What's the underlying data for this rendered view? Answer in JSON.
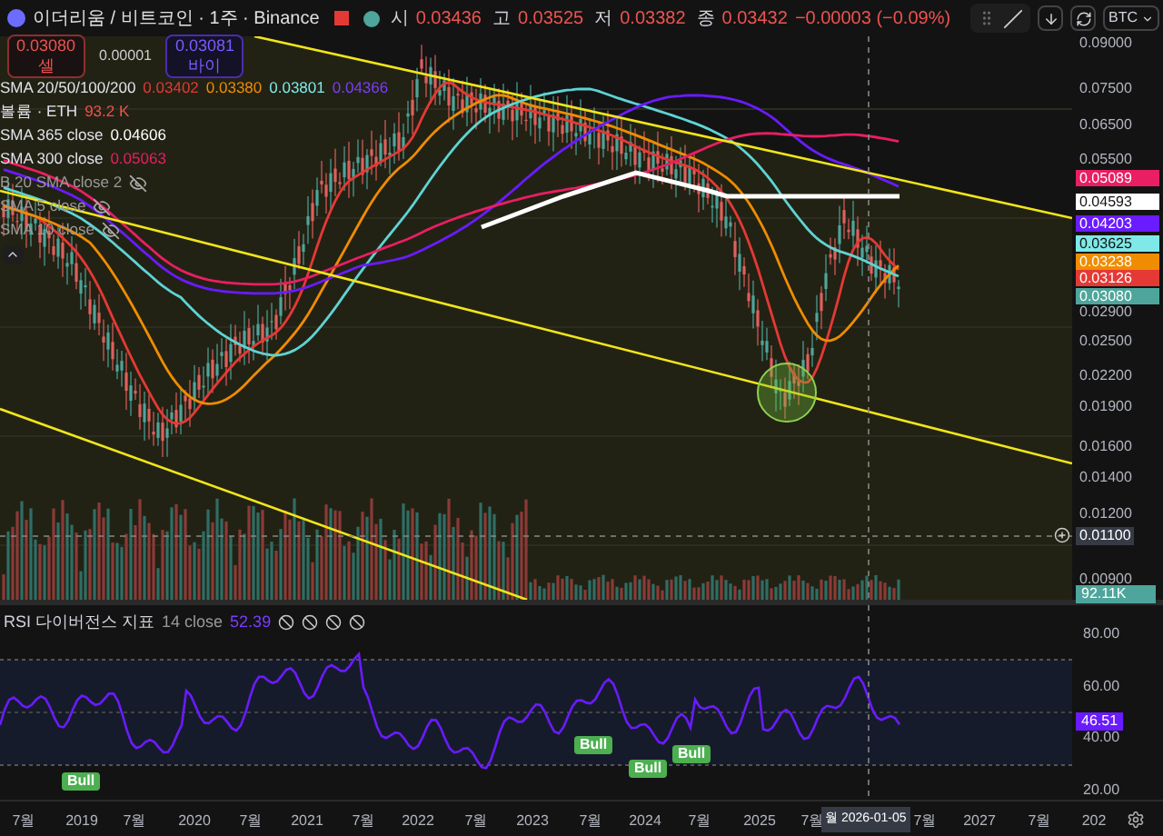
{
  "header": {
    "symbol": "이더리움 / 비트코인 · 1주 · Binance",
    "ohlc": [
      {
        "label": "시",
        "value": "0.03436"
      },
      {
        "label": "고",
        "value": "0.03525"
      },
      {
        "label": "저",
        "value": "0.03382"
      },
      {
        "label": "종",
        "value": "0.03432"
      }
    ],
    "change": "−0.00003 (−0.09%)",
    "currency": "BTC"
  },
  "trade": {
    "sell_price": "0.03080",
    "sell_label": "셀",
    "spread": "0.00001",
    "buy_price": "0.03081",
    "buy_label": "바이"
  },
  "indicators": [
    {
      "name": "SMA 20/50/100/200",
      "hidden": false,
      "values": [
        {
          "value": "0.03402",
          "color": "#e53935"
        },
        {
          "value": "0.03380",
          "color": "#f08c00"
        },
        {
          "value": "0.03801",
          "color": "#7fe8e8"
        },
        {
          "value": "0.04366",
          "color": "#7c3cff"
        }
      ]
    },
    {
      "name": "볼륨 · ETH",
      "hidden": false,
      "values": [
        {
          "value": "93.2 K",
          "color": "#ef5350"
        }
      ]
    },
    {
      "name": "SMA 365 close",
      "hidden": false,
      "values": [
        {
          "value": "0.04606",
          "color": "#ffffff"
        }
      ]
    },
    {
      "name": "SMA 300 close",
      "hidden": false,
      "values": [
        {
          "value": "0.05063",
          "color": "#e91e63"
        }
      ]
    },
    {
      "name": "B 20 SMA close 2",
      "hidden": true
    },
    {
      "name": "SMA 5 close",
      "hidden": true
    },
    {
      "name": "SMA 10 close",
      "hidden": true
    }
  ],
  "price_axis": {
    "ticks": [
      "0.09000",
      "0.07500",
      "0.06500",
      "0.05500",
      "0.02900",
      "0.02500",
      "0.02200",
      "0.01900",
      "0.01600",
      "0.01400",
      "0.01200",
      "0.00900"
    ],
    "badges": [
      {
        "value": "0.05089",
        "color": "#e91e63",
        "kind": "dark"
      },
      {
        "value": "0.04593",
        "color": "#ffffff",
        "kind": "light"
      },
      {
        "value": "0.04203",
        "color": "#6a1bff",
        "kind": "dark"
      },
      {
        "value": "0.03625",
        "color": "#7fe8e8",
        "kind": "light"
      },
      {
        "value": "0.03238",
        "color": "#f08c00",
        "kind": "dark"
      },
      {
        "value": "0.03126",
        "color": "#e53935",
        "kind": "dark"
      },
      {
        "value": "0.03080",
        "color": "#4ea59b",
        "kind": "dark"
      }
    ],
    "crosshair_price": "0.01100",
    "volume_badge": "92.11K"
  },
  "rsi": {
    "name": "RSI 다이버전스 지표",
    "params": "14 close",
    "value": "52.39",
    "ticks": [
      "80.00",
      "60.00",
      "40.00",
      "20.00"
    ],
    "badge": "46.51",
    "signals": [
      "Bull",
      "Bull",
      "Bull",
      "Bull"
    ]
  },
  "time_axis": {
    "labels": [
      "7월",
      "2019",
      "7월",
      "2020",
      "7월",
      "2021",
      "7월",
      "2022",
      "7월",
      "2023",
      "7월",
      "2024",
      "7월",
      "2025",
      "7월",
      "7월",
      "2027",
      "7월",
      "202"
    ],
    "crosshair_date": "월 2026-01-05"
  }
}
